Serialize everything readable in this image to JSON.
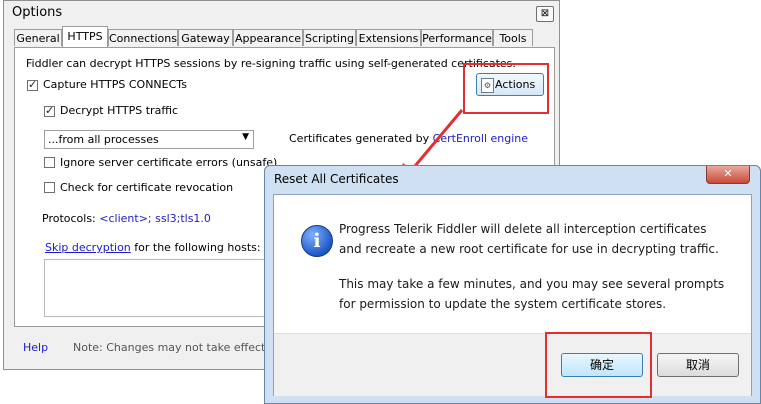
{
  "options": {
    "title": "Options",
    "close_glyph": "⊠",
    "tabs": [
      "General",
      "HTTPS",
      "Connections",
      "Gateway",
      "Appearance",
      "Scripting",
      "Extensions",
      "Performance",
      "Tools"
    ],
    "description": "Fiddler can decrypt HTTPS sessions by re-signing traffic using self-generated certificates.",
    "capture_label": "Capture HTTPS CONNECTs",
    "capture_checked": true,
    "decrypt_label": "Decrypt HTTPS traffic",
    "decrypt_checked": true,
    "process_select": "...from all processes",
    "certs_prefix": "Certificates generated by ",
    "certs_engine": "CertEnroll engine",
    "ignore_errors_label": "Ignore server certificate errors (unsafe)",
    "revocation_label": "Check for certificate revocation",
    "protocols_label": "Protocols: ",
    "protocols_value": "<client>; ssl3;tls1.0",
    "skip_link": "Skip decryption",
    "skip_suffix": " for the following hosts:",
    "actions_label": "Actions",
    "help_link": "Help",
    "note": "Note: Changes may not take effect unt"
  },
  "dialog": {
    "title": "Reset All Certificates",
    "close_glyph": "✕",
    "message_line1": "Progress Telerik Fiddler will delete all interception certificates",
    "message_line2": "and recreate a new root certificate for use in decrypting traffic.",
    "message_line3": "This may take a few minutes, and you may see several prompts",
    "message_line4": "for permission to update the system certificate stores.",
    "ok_label": "确定",
    "cancel_label": "取消"
  },
  "colors": {
    "highlight": "#e03030",
    "link": "#1a1acc"
  }
}
